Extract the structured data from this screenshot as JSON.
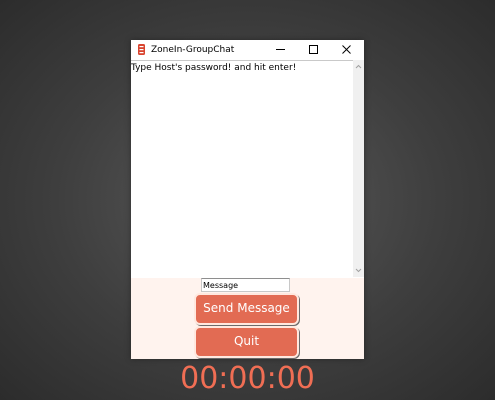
{
  "window": {
    "title": "ZoneIn-GroupChat",
    "controls": {
      "minimize_icon": "minimize-icon",
      "maximize_icon": "maximize-icon",
      "close_icon": "close-icon"
    }
  },
  "chat": {
    "log_text": "Type Host's password! and hit enter!"
  },
  "input": {
    "value": "Message"
  },
  "buttons": {
    "send_label": "Send Message",
    "quit_label": "Quit"
  },
  "timer": {
    "value": "00:00:00"
  },
  "colors": {
    "accent": "#e26b53",
    "timer": "#f06e54",
    "panel_bg": "#fff3ee",
    "desktop_bg": "#3e3e3e"
  }
}
